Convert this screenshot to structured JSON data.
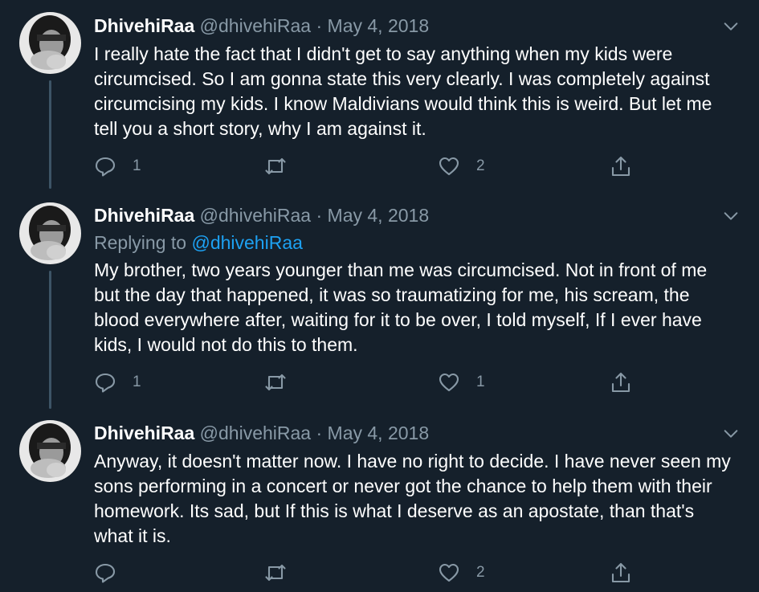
{
  "colors": {
    "background": "#15202b",
    "text": "#ffffff",
    "muted": "#8899a6",
    "mention": "#1da1f2",
    "thread_line": "#3d5466"
  },
  "tweets": [
    {
      "name": "DhivehiRaa",
      "handle": "@dhivehiRaa",
      "separator": "·",
      "date": "May 4, 2018",
      "replying_prefix": "",
      "replying_handle": "",
      "text": "I really hate the fact that I didn't get to say anything when my kids were circumcised. So I am gonna state this very clearly. I was completely against circumcising my kids. I know Maldivians would think this is weird. But let me tell you a short story, why I am against it.",
      "replies": "1",
      "retweets": "",
      "likes": "2"
    },
    {
      "name": "DhivehiRaa",
      "handle": "@dhivehiRaa",
      "separator": "·",
      "date": "May 4, 2018",
      "replying_prefix": "Replying to",
      "replying_handle": "@dhivehiRaa",
      "text": "My brother, two years younger than me was circumcised. Not in front of me but the day that happened, it was so traumatizing for me, his scream, the blood everywhere after, waiting for it to be over, I told myself, If I ever have kids, I would not do this to them.",
      "replies": "1",
      "retweets": "",
      "likes": "1"
    },
    {
      "name": "DhivehiRaa",
      "handle": "@dhivehiRaa",
      "separator": "·",
      "date": "May 4, 2018",
      "replying_prefix": "",
      "replying_handle": "",
      "text": "Anyway, it doesn't matter now. I have no right to decide. I have never seen my sons performing in a concert or never got the chance to help them with their homework. Its sad, but If this is what I deserve as an apostate, than that's what it is.",
      "replies": "",
      "retweets": "",
      "likes": "2"
    }
  ],
  "icons": {
    "reply": "reply-icon",
    "retweet": "retweet-icon",
    "like": "heart-icon",
    "share": "share-icon",
    "more": "chevron-down-icon"
  }
}
